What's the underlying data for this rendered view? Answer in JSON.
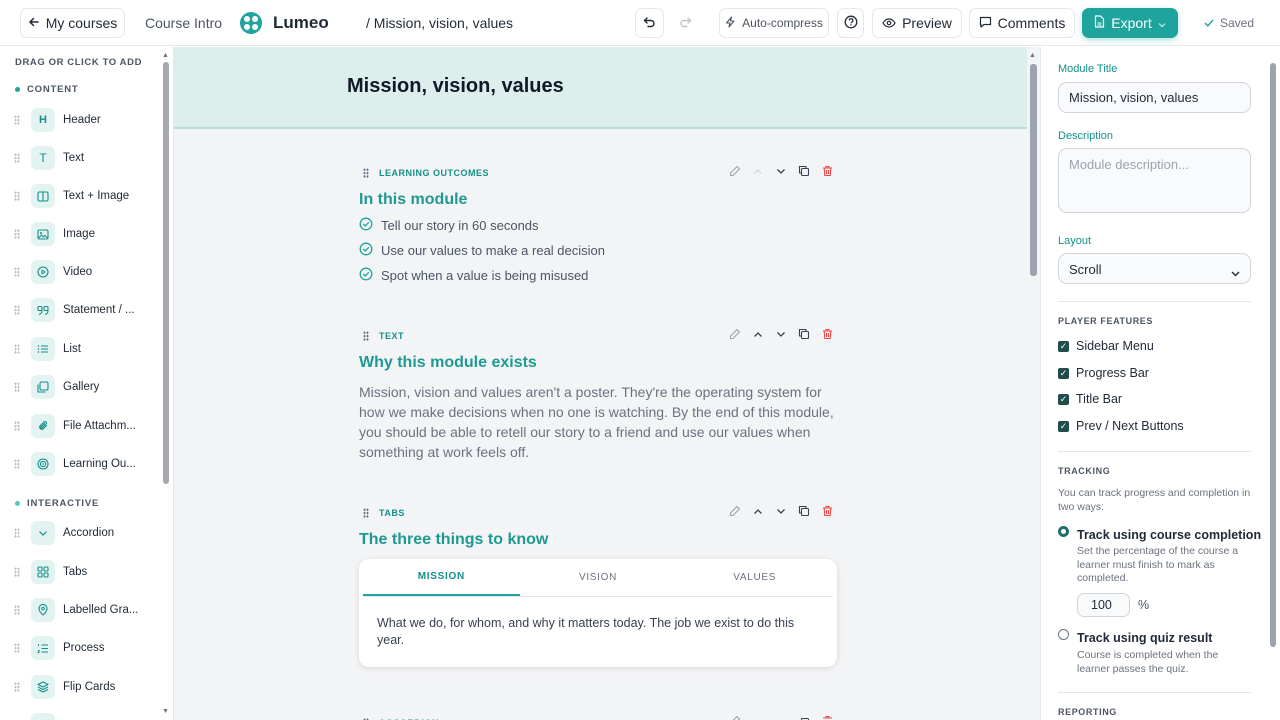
{
  "topbar": {
    "back_label": "My courses",
    "course_intro": "Course Intro",
    "brand": "Lumeo",
    "breadcrumb": "/ Mission, vision, values",
    "auto_compress": "Auto-compress",
    "preview": "Preview",
    "comments": "Comments",
    "export": "Export",
    "saved": "Saved"
  },
  "sidebar": {
    "title": "DRAG OR CLICK TO ADD",
    "content_section": "CONTENT",
    "interactive_section": "INTERACTIVE",
    "content_items": [
      {
        "label": "Header",
        "icon": "H"
      },
      {
        "label": "Text",
        "icon": "T"
      },
      {
        "label": "Text + Image",
        "icon": "text-image-icon"
      },
      {
        "label": "Image",
        "icon": "image-icon"
      },
      {
        "label": "Video",
        "icon": "play-icon"
      },
      {
        "label": "Statement / ...",
        "icon": "quote-icon"
      },
      {
        "label": "List",
        "icon": "list-icon"
      },
      {
        "label": "Gallery",
        "icon": "gallery-icon"
      },
      {
        "label": "File Attachm...",
        "icon": "paperclip-icon"
      },
      {
        "label": "Learning Ou...",
        "icon": "target-icon"
      }
    ],
    "interactive_items": [
      {
        "label": "Accordion",
        "icon": "chevron-down-icon"
      },
      {
        "label": "Tabs",
        "icon": "tabs-icon"
      },
      {
        "label": "Labelled Gra...",
        "icon": "pin-icon"
      },
      {
        "label": "Process",
        "icon": "ordered-list-icon"
      },
      {
        "label": "Flip Cards",
        "icon": "layers-icon"
      }
    ]
  },
  "canvas": {
    "module_title": "Mission, vision, values",
    "outcomes_block": {
      "type": "LEARNING OUTCOMES",
      "heading": "In this module",
      "items": [
        "Tell our story in 60 seconds",
        "Use our values to make a real decision",
        "Spot when a value is being misused"
      ]
    },
    "text_block": {
      "type": "TEXT",
      "heading": "Why this module exists",
      "body": "Mission, vision and values aren't a poster. They're the operating system for how we make decisions when no one is watching. By the end of this module, you should be able to retell our story to a friend and use our values when something at work feels off."
    },
    "tabs_block": {
      "type": "TABS",
      "heading": "The three things to know",
      "tabs": [
        "MISSION",
        "VISION",
        "VALUES"
      ],
      "active_tab": "MISSION",
      "body": "What we do, for whom, and why it matters today. The job we exist to do this year."
    },
    "next_block_type": "ACCORDION"
  },
  "settings": {
    "module_title_label": "Module Title",
    "module_title_value": "Mission, vision, values",
    "description_label": "Description",
    "description_placeholder": "Module description...",
    "layout_label": "Layout",
    "layout_value": "Scroll",
    "player_features_title": "PLAYER FEATURES",
    "features": [
      {
        "label": "Sidebar Menu",
        "checked": true
      },
      {
        "label": "Progress Bar",
        "checked": true
      },
      {
        "label": "Title Bar",
        "checked": true
      },
      {
        "label": "Prev / Next Buttons",
        "checked": true
      }
    ],
    "tracking_title": "TRACKING",
    "tracking_intro": "You can track progress and completion in two ways:",
    "track_completion_label": "Track using course completion",
    "track_completion_desc": "Set the percentage of the course a learner must finish to mark as completed.",
    "completion_percent": "100",
    "percent_sign": "%",
    "track_quiz_label": "Track using quiz result",
    "track_quiz_desc": "Course is completed when the learner passes the quiz.",
    "reporting_title": "REPORTING"
  },
  "colors": {
    "accent": "#1fa39d",
    "accent_text": "#148f89",
    "hero_bg": "#dcefec",
    "delete": "#ef4444"
  }
}
